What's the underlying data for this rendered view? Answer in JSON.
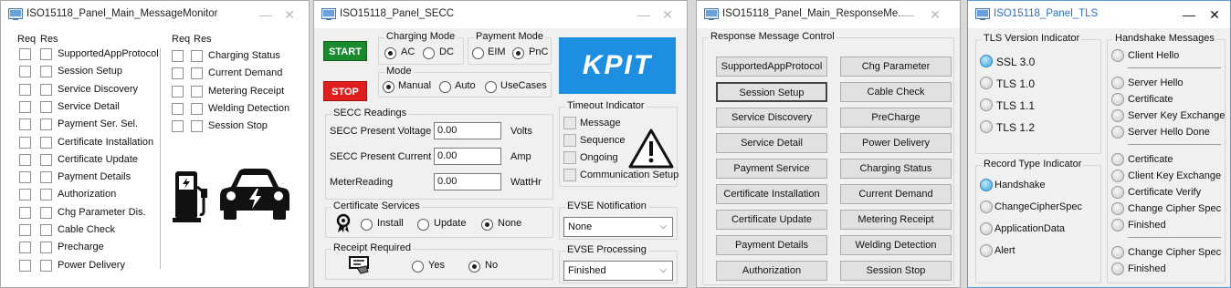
{
  "win1": {
    "title": "ISO15118_Panel_Main_MessageMonitor",
    "req": "Req",
    "res": "Res",
    "left": [
      "SupportedAppProtocol",
      "Session Setup",
      "Service Discovery",
      "Service Detail",
      "Payment Ser. Sel.",
      "Certificate Installation",
      "Certificate Update",
      "Payment Details",
      "Authorization",
      "Chg Parameter Dis.",
      "Cable Check",
      "Precharge",
      "Power Delivery"
    ],
    "right": [
      "Charging Status",
      "Current Demand",
      "Metering Receipt",
      "Welding Detection",
      "Session Stop"
    ]
  },
  "win2": {
    "title": "ISO15118_Panel_SECC",
    "start": "START",
    "stop": "STOP",
    "charging_mode": {
      "title": "Charging Mode",
      "ac": "AC",
      "dc": "DC"
    },
    "payment_mode": {
      "title": "Payment Mode",
      "eim": "EIM",
      "pnc": "PnC"
    },
    "mode": {
      "title": "Mode",
      "manual": "Manual",
      "auto": "Auto",
      "usecases": "UseCases"
    },
    "logo": "KPIT",
    "timeout": {
      "title": "Timeout Indicator",
      "message": "Message",
      "sequence": "Sequence",
      "ongoing": "Ongoing",
      "comm": "Communication Setup"
    },
    "readings": {
      "title": "SECC Readings",
      "voltage_label": "SECC Present Voltage",
      "voltage": "0.00",
      "voltage_unit": "Volts",
      "current_label": "SECC Present Current",
      "current": "0.00",
      "current_unit": "Amp",
      "meter_label": "MeterReading",
      "meter": "0.00",
      "meter_unit": "WattHr"
    },
    "cert": {
      "title": "Certificate Services",
      "install": "Install",
      "update": "Update",
      "none": "None"
    },
    "evse_notif": {
      "title": "EVSE Notification",
      "value": "None"
    },
    "receipt": {
      "title": "Receipt Required",
      "yes": "Yes",
      "no": "No"
    },
    "evse_proc": {
      "title": "EVSE Processing",
      "value": "Finished"
    }
  },
  "win3": {
    "title": "ISO15118_Panel_Main_ResponseMe...",
    "group": "Response Message Control",
    "left": [
      "SupportedAppProtocol",
      "Session Setup",
      "Service Discovery",
      "Service Detail",
      "Payment Service",
      "Certificate Installation",
      "Certificate Update",
      "Payment Details",
      "Authorization"
    ],
    "right": [
      "Chg Parameter",
      "Cable Check",
      "PreCharge",
      "Power Delivery",
      "Charging Status",
      "Current Demand",
      "Metering Receipt",
      "Welding Detection",
      "Session Stop"
    ]
  },
  "win4": {
    "title": "ISO15118_Panel_TLS",
    "tls_title": "TLS Version Indicator",
    "tls": [
      "SSL 3.0",
      "TLS 1.0",
      "TLS 1.1",
      "TLS 1.2"
    ],
    "record_title": "Record Type Indicator",
    "record": [
      "Handshake",
      "ChangeCipherSpec",
      "ApplicationData",
      "Alert"
    ],
    "hs_title": "Handshake Messages",
    "hs1": [
      "Client Hello"
    ],
    "hs2": [
      "Server Hello",
      "Certificate",
      "Server Key Exchange",
      "Server Hello Done"
    ],
    "hs3": [
      "Certificate",
      "Client Key Exchange",
      "Certificate Verify",
      "Change Cipher Spec",
      "Finished"
    ],
    "hs4": [
      "Change Cipher Spec",
      "Finished"
    ]
  },
  "colors": {
    "start": "#1a8a2e",
    "stop": "#e01f1f",
    "kpit": "#1e8fe0",
    "led_on": "#3aa3e0"
  }
}
